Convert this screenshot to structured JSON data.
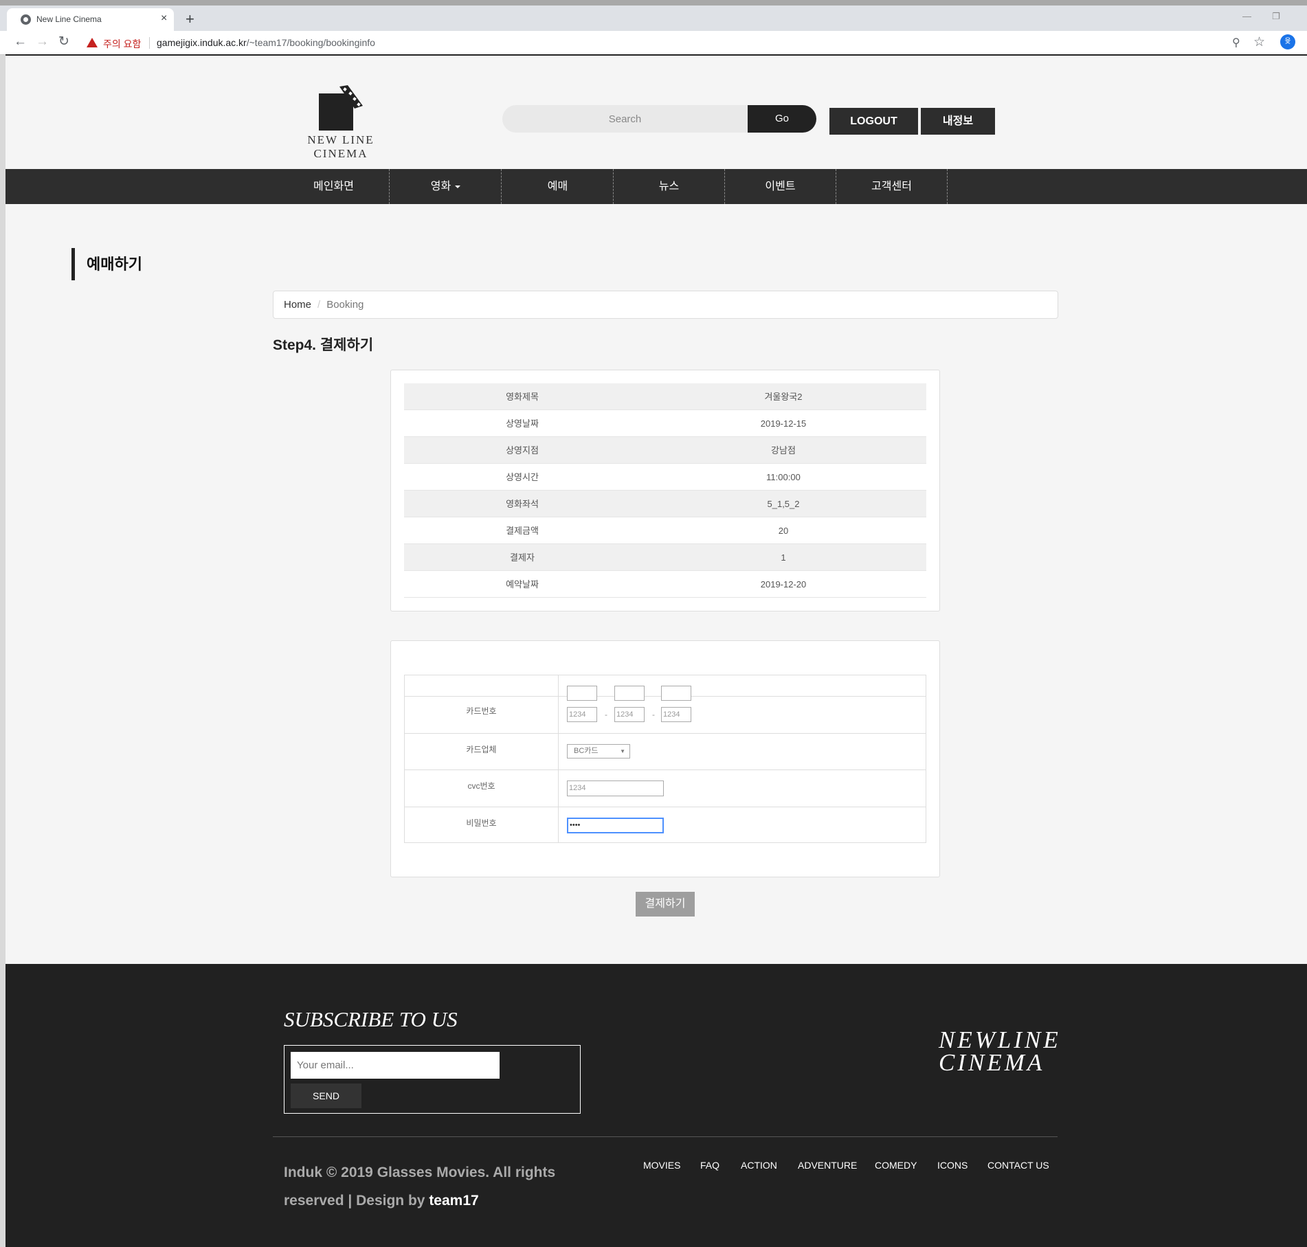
{
  "browser": {
    "tab_title": "New Line Cinema",
    "tab_close": "×",
    "new_tab": "+",
    "warning_text": "주의 요함",
    "url_host": "gamejigix.induk.ac.kr",
    "url_path": "/~team17/booking/bookinginfo",
    "profile_initial": "윷"
  },
  "header": {
    "logo_text": "NEW LINE CINEMA",
    "search_placeholder": "Search",
    "go_label": "Go",
    "logout_label": "LOGOUT",
    "myinfo_label": "내정보"
  },
  "nav": {
    "items": [
      "메인화면",
      "영화",
      "예매",
      "뉴스",
      "이벤트",
      "고객센터"
    ]
  },
  "section_title": "예매하기",
  "breadcrumb": {
    "home": "Home",
    "separator": "/",
    "current": "Booking"
  },
  "step_title": "Step4. 결제하기",
  "booking_info": [
    {
      "label": "영화제목",
      "value": "겨울왕국2"
    },
    {
      "label": "상영날짜",
      "value": "2019-12-15"
    },
    {
      "label": "상영지점",
      "value": "강남점"
    },
    {
      "label": "상영시간",
      "value": "11:00:00"
    },
    {
      "label": "영화좌석",
      "value": "5_1,5_2"
    },
    {
      "label": "결제금액",
      "value": "20"
    },
    {
      "label": "결제자",
      "value": "1"
    },
    {
      "label": "예약날짜",
      "value": "2019-12-20"
    }
  ],
  "payment_form": {
    "card_number_label": "카드번호",
    "card_number_placeholder": "1234",
    "dash": "-",
    "card_company_label": "카드업체",
    "card_company_value": "BC카드",
    "cvc_label": "cvc번호",
    "cvc_placeholder": "1234",
    "password_label": "비밀번호",
    "password_value": "••••"
  },
  "pay_button": "결제하기",
  "footer": {
    "subscribe_title": "SUBSCRIBE TO US",
    "email_placeholder": "Your email...",
    "send_label": "SEND",
    "logo_line1": "NEWLINE",
    "logo_line2": "CINEMA",
    "copyright": "Induk © 2019 Glasses Movies. All rights reserved | Design by",
    "design_by": "team17",
    "links": [
      "MOVIES",
      "FAQ",
      "ACTION",
      "ADVENTURE",
      "COMEDY",
      "ICONS",
      "CONTACT US"
    ]
  }
}
